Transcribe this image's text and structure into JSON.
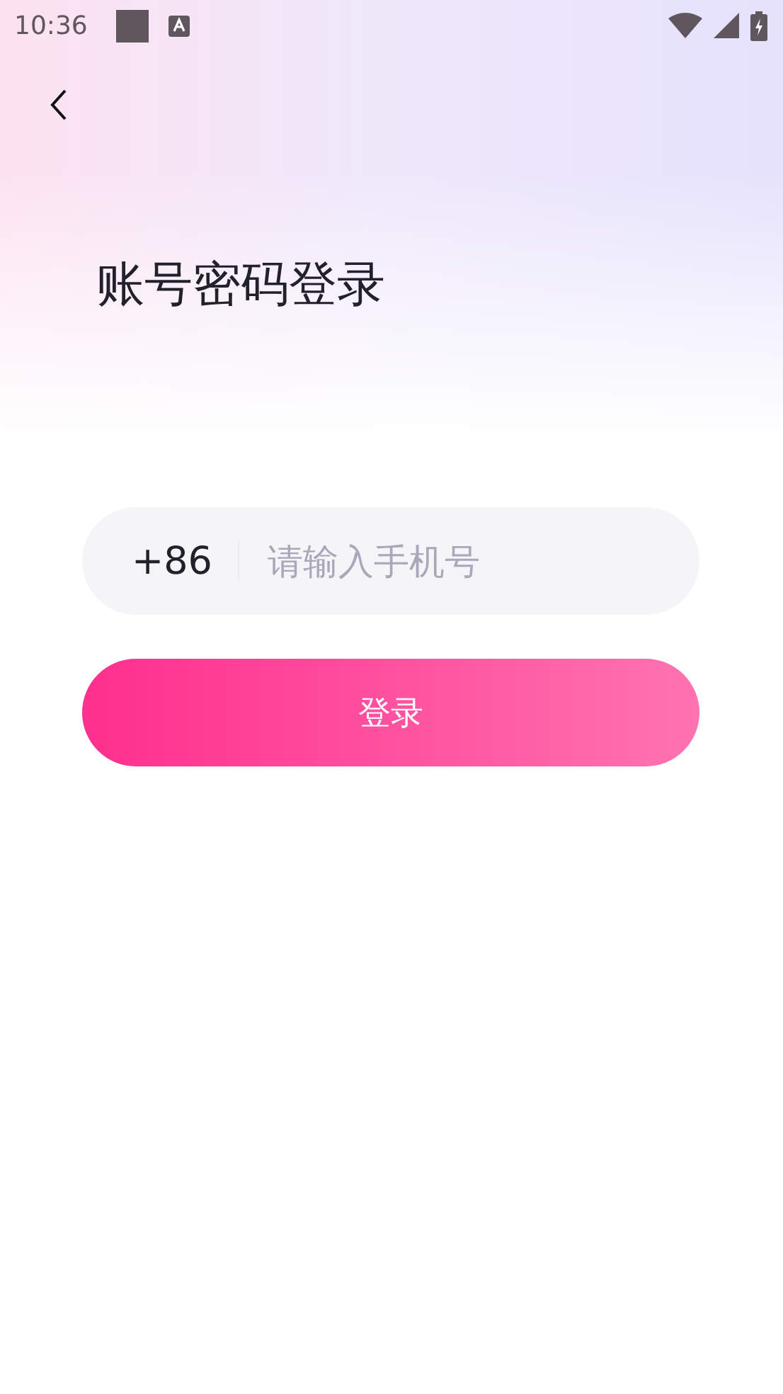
{
  "status_bar": {
    "time": "10:36"
  },
  "title": "账号密码登录",
  "phone_field": {
    "country_code": "+86",
    "placeholder": "请输入手机号"
  },
  "login_button": {
    "label": "登录"
  }
}
